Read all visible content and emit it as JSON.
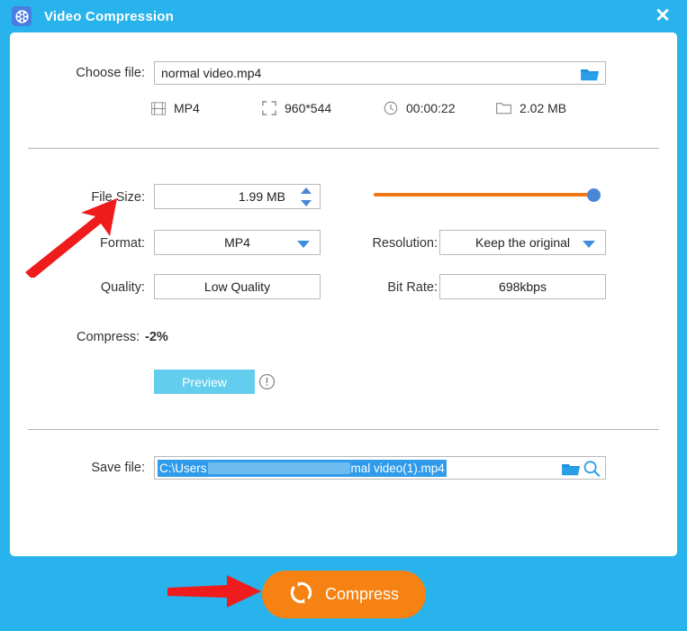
{
  "window": {
    "title": "Video Compression",
    "app_icon": "film-reel-icon",
    "close_label": "✕",
    "titlebar_color": "#29b3ec",
    "accent_orange": "#f58212",
    "accent_blue": "#4a86d6"
  },
  "choose_file": {
    "label": "Choose file:",
    "value": "normal video.mp4",
    "browse_icon": "folder-open-icon"
  },
  "meta": [
    {
      "icon": "film-strip-icon",
      "text": "MP4"
    },
    {
      "icon": "resize-icon",
      "text": "960*544"
    },
    {
      "icon": "clock-icon",
      "text": "00:00:22"
    },
    {
      "icon": "folder-icon",
      "text": "2.02 MB"
    }
  ],
  "settings": {
    "file_size_label": "File Size:",
    "file_size_value": "1.99 MB",
    "format_label": "Format:",
    "format_value": "MP4",
    "resolution_label": "Resolution:",
    "resolution_value": "Keep the original",
    "quality_label": "Quality:",
    "quality_value": "Low Quality",
    "bitrate_label": "Bit Rate:",
    "bitrate_value": "698kbps",
    "slider_percent": 96
  },
  "compress_info": {
    "label": "Compress:",
    "value": "-2%",
    "preview_label": "Preview",
    "info_icon": "exclamation-circle-icon"
  },
  "save_file": {
    "label": "Save file:",
    "path_prefix": "C:\\Users",
    "path_suffix": "mal video(1).mp4",
    "folder_icon": "folder-open-icon",
    "search_icon": "magnifier-icon"
  },
  "footer": {
    "compress_button_label": "Compress",
    "compress_button_icon": "refresh-sync-icon"
  },
  "annotations": [
    {
      "name": "arrow-to-file-size",
      "color": "#ee1c1c"
    },
    {
      "name": "arrow-to-compress-button",
      "color": "#ee1c1c"
    }
  ]
}
